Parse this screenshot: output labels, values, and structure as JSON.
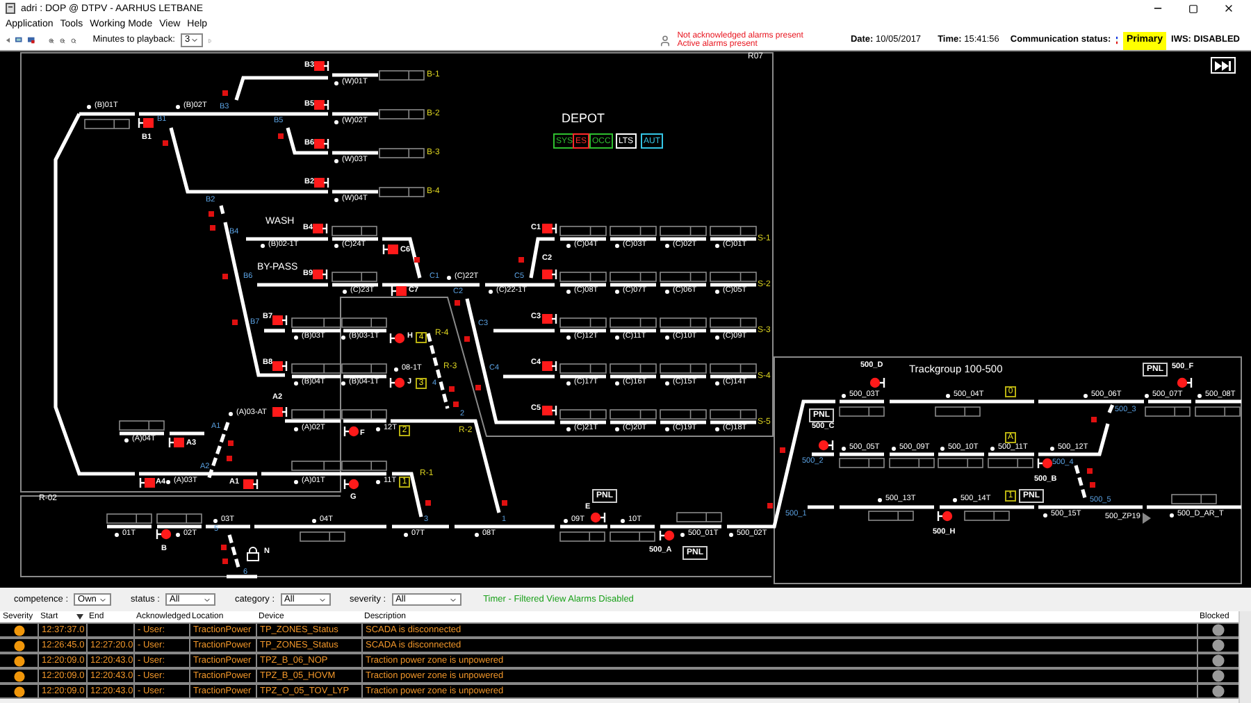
{
  "window": {
    "title": "adri : DOP @ DTPV - AARHUS LETBANE"
  },
  "menu": [
    "Application",
    "Tools",
    "Working Mode",
    "View",
    "Help"
  ],
  "toolbar": {
    "playback_label": "Minutes to playback:",
    "playback_value": "3"
  },
  "alarm_status": [
    "Not acknowledged alarms present",
    "Active alarms present"
  ],
  "date": {
    "label": "Date:",
    "value": "10/05/2017"
  },
  "time": {
    "label": "Time:",
    "value": "15:41:56"
  },
  "communication": {
    "label": "Communication status:",
    "value": "Primary"
  },
  "iws": "IWS: DISABLED",
  "schematic": {
    "frames": [
      "R07",
      "R-02"
    ],
    "depot_title": "DEPOT",
    "modes": [
      {
        "label": "SYS",
        "color": "#2fbf2f"
      },
      {
        "label": "ES",
        "color": "#ff2a2a"
      },
      {
        "label": "OCC",
        "color": "#2fbf2f"
      },
      {
        "label": "LTS",
        "color": "#ffffff"
      },
      {
        "label": "AUT",
        "color": "#35c6e6"
      }
    ],
    "areas": [
      "WASH",
      "BY-PASS"
    ],
    "trackgroup_title": "Trackgroup 100-500",
    "tracks": [
      "(B)01T",
      "(B)02T",
      "(W)01T",
      "(W)02T",
      "(W)03T",
      "(W)04T",
      "(B)02-1T",
      "(C)24T",
      "(C)23T",
      "(B)03T",
      "(B)03-1T",
      "08-1T",
      "(B)04T",
      "(B)04-1T",
      "(A)03-AT",
      "(A)02T",
      "12T",
      "(A)04T",
      "(A)03T",
      "(A)01T",
      "11T",
      "(C)22T",
      "(C)22-1T",
      "(C)04T",
      "(C)03T",
      "(C)02T",
      "(C)01T",
      "(C)08T",
      "(C)07T",
      "(C)06T",
      "(C)05T",
      "(C)12T",
      "(C)11T",
      "(C)10T",
      "(C)09T",
      "(C)17T",
      "(C)16T",
      "(C)15T",
      "(C)14T",
      "(C)21T",
      "(C)20T",
      "(C)19T",
      "(C)18T",
      "03T",
      "04T",
      "01T",
      "02T",
      "07T",
      "08T",
      "09T",
      "10T",
      "500_01T",
      "500_02T",
      "500_03T",
      "500_04T",
      "500_06T",
      "500_07T",
      "500_08T",
      "500_05T",
      "500_09T",
      "500_10T",
      "500_11T",
      "500_12T",
      "500_13T",
      "500_14T",
      "500_15T",
      "500_D_AR_T"
    ],
    "signals": [
      {
        "label": "B3",
        "kind": "square"
      },
      {
        "label": "B5",
        "kind": "square"
      },
      {
        "label": "B6",
        "kind": "square"
      },
      {
        "label": "B2",
        "kind": "square"
      },
      {
        "label": "B1",
        "kind": "square"
      },
      {
        "label": "B4",
        "kind": "square"
      },
      {
        "label": "B9",
        "kind": "square"
      },
      {
        "label": "B7",
        "kind": "square"
      },
      {
        "label": "B8",
        "kind": "square"
      },
      {
        "label": "A2",
        "kind": "square"
      },
      {
        "label": "A3",
        "kind": "square"
      },
      {
        "label": "A4",
        "kind": "square"
      },
      {
        "label": "A1",
        "kind": "square"
      },
      {
        "label": "C6",
        "kind": "square"
      },
      {
        "label": "C7",
        "kind": "square"
      },
      {
        "label": "H",
        "kind": "round"
      },
      {
        "label": "J",
        "kind": "round"
      },
      {
        "label": "F",
        "kind": "round"
      },
      {
        "label": "G",
        "kind": "round"
      },
      {
        "label": "B",
        "kind": "round"
      },
      {
        "label": "C1",
        "kind": "square"
      },
      {
        "label": "C2",
        "kind": "square"
      },
      {
        "label": "C3",
        "kind": "square"
      },
      {
        "label": "C4",
        "kind": "square"
      },
      {
        "label": "C5",
        "kind": "square"
      },
      {
        "label": "E",
        "kind": "round"
      },
      {
        "label": "500_A",
        "kind": "round"
      },
      {
        "label": "500_D",
        "kind": "round"
      },
      {
        "label": "500_F",
        "kind": "round"
      },
      {
        "label": "500_C",
        "kind": "round"
      },
      {
        "label": "500_B",
        "kind": "round"
      },
      {
        "label": "500_H",
        "kind": "round"
      },
      {
        "label": "N",
        "kind": "lock"
      }
    ],
    "points": [
      "B1",
      "B3",
      "B5",
      "B2",
      "B4",
      "B6",
      "B7",
      "A1",
      "A2",
      "5",
      "6",
      "C1",
      "C5",
      "C2",
      "C3",
      "C4",
      "4",
      "2",
      "3",
      "1",
      "500_1",
      "500_2",
      "500_3",
      "500_4",
      "500_5"
    ],
    "routes": [
      "B-1",
      "B-2",
      "B-3",
      "B-4",
      "S-1",
      "S-2",
      "S-3",
      "S-4",
      "S-5",
      "R-4",
      "R-3",
      "R-2",
      "R-1"
    ],
    "route_numbers": [
      "4",
      "3",
      "2",
      "1",
      "0",
      "A",
      "1"
    ],
    "panels": [
      "PNL",
      "PNL",
      "PNL",
      "PNL",
      "PNL"
    ],
    "end_marker": "500_ZP19"
  },
  "filters": [
    {
      "label": "competence :",
      "value": "Own"
    },
    {
      "label": "status :",
      "value": "All"
    },
    {
      "label": "category :",
      "value": "All"
    },
    {
      "label": "severity :",
      "value": "All"
    }
  ],
  "filter_note": "Timer - Filtered View Alarms Disabled",
  "alarm_table": {
    "columns": [
      "Severity",
      "Start",
      "End",
      "Acknowledged",
      "Location",
      "Device",
      "Description",
      "Blocked"
    ],
    "rows": [
      {
        "start": "12:37:37.0",
        "acknowledged": "- User:",
        "location": "TractionPower",
        "device": "TP_ZONES_Status",
        "description": "SCADA is disconnected"
      },
      {
        "start": "12:26:45.0",
        "end": "12:27:20.0",
        "acknowledged": "- User:",
        "location": "TractionPower",
        "device": "TP_ZONES_Status",
        "description": "SCADA is disconnected"
      },
      {
        "start": "12:20:09.0",
        "end": "12:20:43.0",
        "acknowledged": "- User:",
        "location": "TractionPower",
        "device": "TPZ_B_06_NOP",
        "description": "Traction power zone is unpowered"
      },
      {
        "start": "12:20:09.0",
        "end": "12:20:43.0",
        "acknowledged": "- User:",
        "location": "TractionPower",
        "device": "TPZ_B_05_HOVM",
        "description": "Traction power zone is unpowered"
      },
      {
        "start": "12:20:09.0",
        "end": "12:20:43.0",
        "acknowledged": "- User:",
        "location": "TractionPower",
        "device": "TPZ_O_05_TOV_LYP",
        "description": "Traction power zone is unpowered"
      }
    ]
  }
}
